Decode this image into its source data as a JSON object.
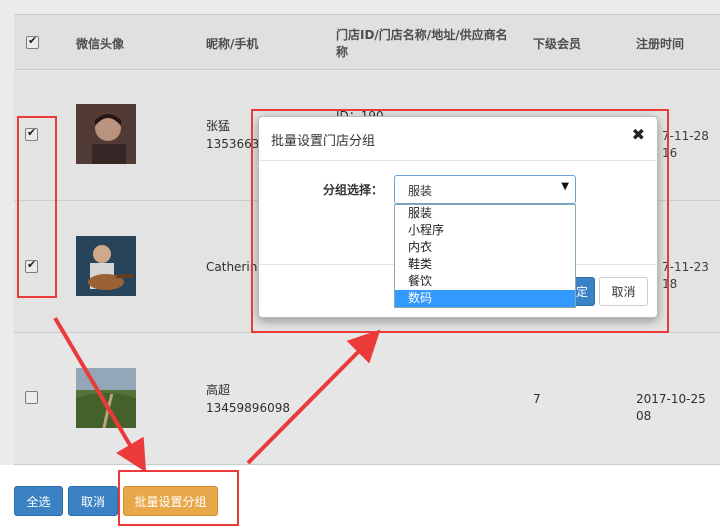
{
  "table": {
    "headers": {
      "avatar": "微信头像",
      "nick": "昵称/手机",
      "store_line1": "门店ID/门店名称/地址/供应商名",
      "store_line2": "称",
      "members": "下级会员",
      "reg": "注册时间"
    },
    "rows": [
      {
        "checked": true,
        "name": "张猛",
        "phone": "13536633",
        "store": "ID：190",
        "members": "",
        "reg": "7-11-28 16"
      },
      {
        "checked": true,
        "name": "Catherine",
        "phone": "",
        "store": "",
        "members": "",
        "reg": "7-11-23 18"
      },
      {
        "checked": false,
        "name": "高超",
        "phone": "13459896098",
        "store": "",
        "members": "7",
        "reg": "2017-10-25 08"
      }
    ]
  },
  "footer": {
    "select_all": "全选",
    "cancel": "取消",
    "batch_group": "批量设置分组"
  },
  "modal": {
    "title": "批量设置门店分组",
    "close": "✖",
    "field_label": "分组选择：",
    "selected": "服装",
    "options": [
      "服装",
      "小程序",
      "内衣",
      "鞋类",
      "餐饮",
      "数码"
    ],
    "highlighted": "数码",
    "confirm_partial": "定",
    "cancel": "取消"
  },
  "colors": {
    "primary": "#3b82c4",
    "warning": "#e8a84a",
    "annotation": "#ea3a3a",
    "highlight": "#3399ff"
  }
}
